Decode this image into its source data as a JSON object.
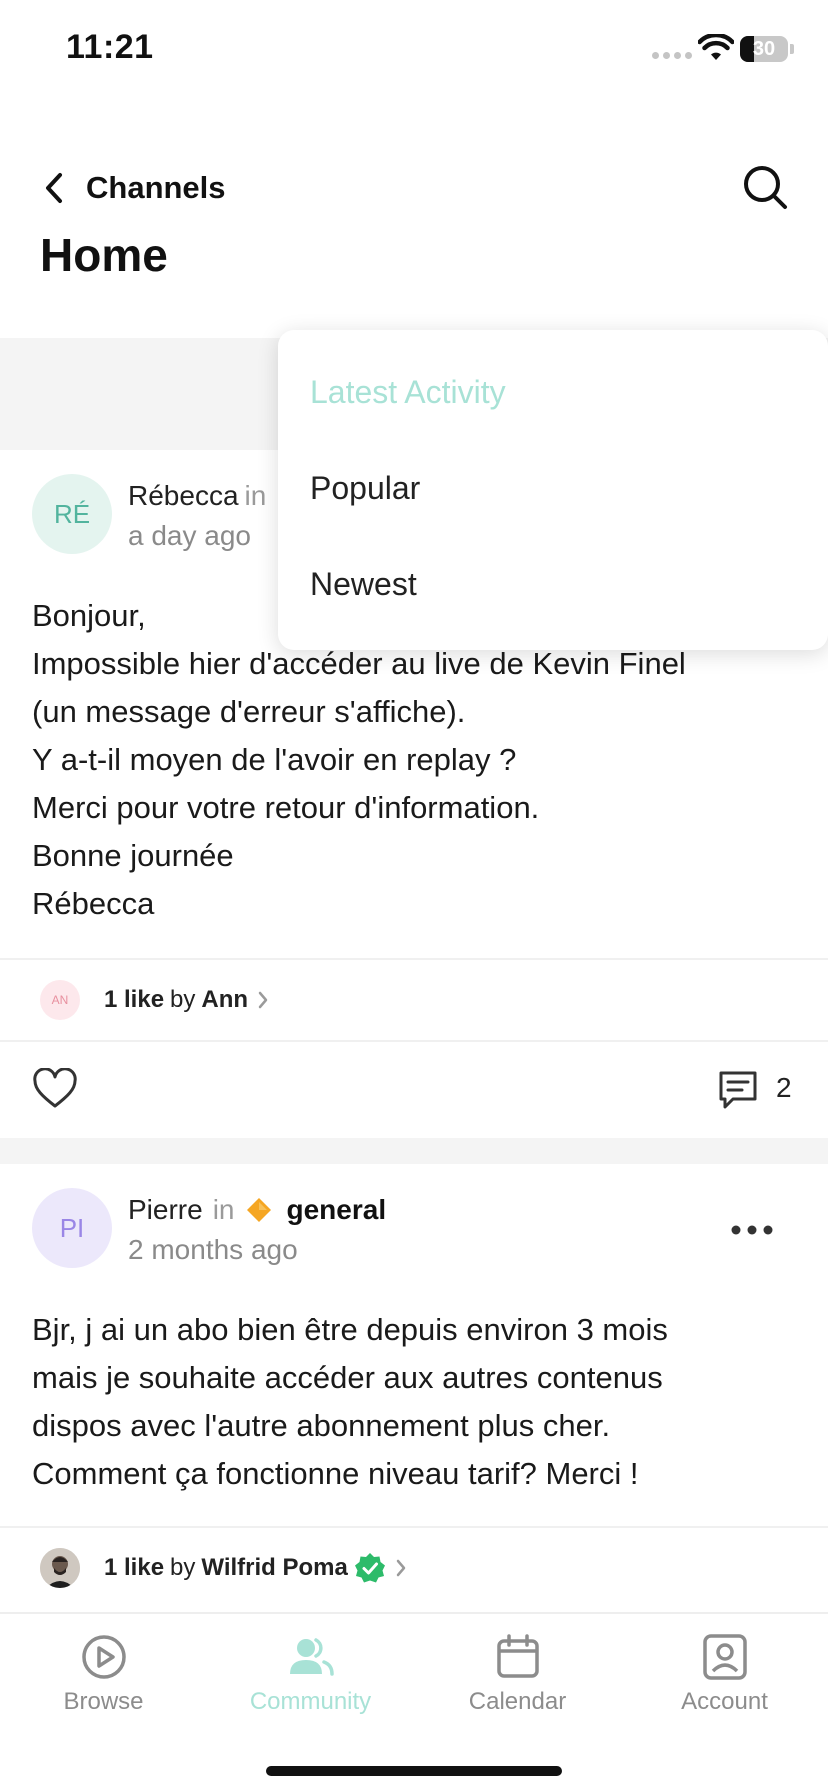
{
  "status_bar": {
    "time": "11:21",
    "battery_level": "30",
    "battery_fraction": 0.3
  },
  "header": {
    "back_label": "Channels",
    "title": "Home",
    "back_icon": "chevron-left-icon",
    "search_icon": "search-icon"
  },
  "sort_menu": {
    "options": [
      "Latest Activity",
      "Popular",
      "Newest"
    ],
    "selected": "Latest Activity",
    "active_color": "#a8e2d6"
  },
  "posts": [
    {
      "avatar_initials": "RÉ",
      "avatar_bg": "#e4f4ef",
      "avatar_color": "#52b49e",
      "author": "Rébecca",
      "in_word": "in",
      "time": "a day ago",
      "body": [
        "Bonjour,",
        "Impossible hier d'accéder au live de Kevin Finel",
        "(un message d'erreur s'affiche).",
        "Y a-t-il moyen de l'avoir en replay ?",
        "Merci pour votre retour d'information.",
        "Bonne journée",
        "Rébecca"
      ],
      "likes": {
        "avatar_initials": "AN",
        "count_label": "1 like",
        "by_word": "by",
        "liker": "Ann"
      },
      "comment_count": "2"
    },
    {
      "avatar_initials": "PI",
      "avatar_bg": "#ece8fb",
      "avatar_color": "#9a86e6",
      "author": "Pierre",
      "in_word": "in",
      "channel": "general",
      "channel_icon": "orange-diamond-icon",
      "time": "2 months ago",
      "body": [
        "Bjr, j ai un abo bien être depuis environ 3 mois",
        "mais je souhaite accéder aux autres contenus",
        "dispos avec l'autre abonnement plus cher.",
        "Comment ça fonctionne niveau tarif? Merci !"
      ],
      "likes": {
        "count_label": "1 like",
        "by_word": "by",
        "liker": "Wilfrid Poma",
        "verified_icon": "verified-badge-icon"
      }
    }
  ],
  "tab_bar": {
    "tabs": [
      {
        "label": "Browse",
        "icon": "play-circle-icon"
      },
      {
        "label": "Community",
        "icon": "people-icon"
      },
      {
        "label": "Calendar",
        "icon": "calendar-icon"
      },
      {
        "label": "Account",
        "icon": "account-icon"
      }
    ],
    "active_tab": "Community",
    "inactive_color": "#8c8c8c",
    "active_color": "#a8e2d6"
  }
}
